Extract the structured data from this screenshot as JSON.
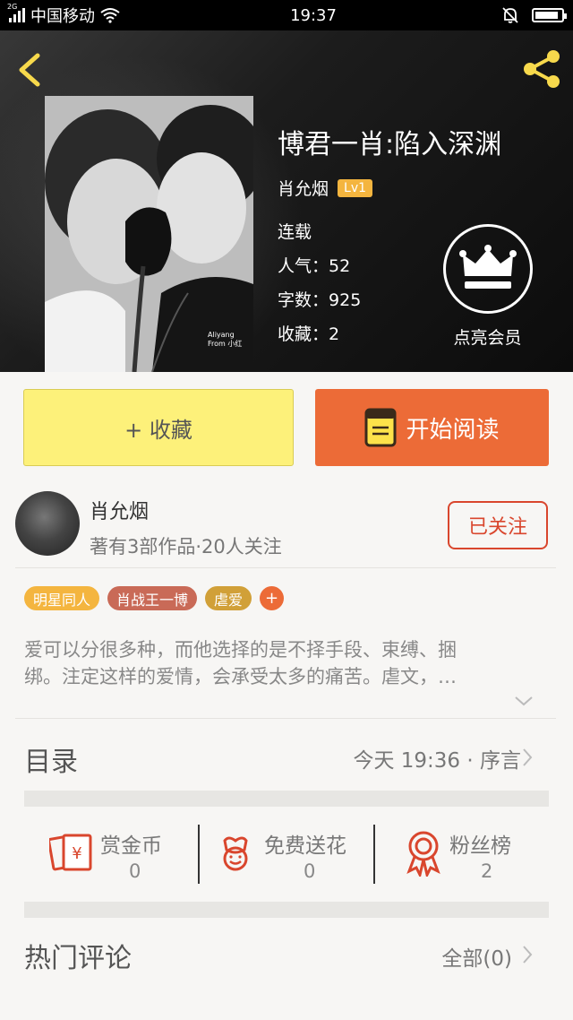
{
  "status_bar": {
    "network": "2G",
    "carrier": "中国移动",
    "time": "19:37",
    "battery_level": 0.9
  },
  "book": {
    "title": "博君一肖:陷入深渊",
    "author": "肖允烟",
    "level": "Lv1",
    "status": "连载",
    "popularity_label": "人气：",
    "popularity": "52",
    "words_label": "字数：",
    "words": "925",
    "favorites_label": "收藏：",
    "favorites": "2",
    "cover_watermark": "Aliyang From 小红"
  },
  "vip": {
    "label": "点亮会员"
  },
  "actions": {
    "collect": "+ 收藏",
    "read": "开始阅读"
  },
  "author_block": {
    "name": "肖允烟",
    "subtitle": "著有3部作品·20人关注",
    "follow": "已关注"
  },
  "tags": [
    {
      "label": "明星同人",
      "color": "#f4b53f"
    },
    {
      "label": "肖战王一博",
      "color": "#c96a57"
    },
    {
      "label": "虐爱",
      "color": "#d1a038"
    }
  ],
  "synopsis": {
    "line1": "爱可以分很多种，而他选择的是不择手段、束缚、捆",
    "line2": "绑。注定这样的爱情，会承受太多的痛苦。虐文，…"
  },
  "catalog": {
    "title": "目录",
    "meta": "今天 19:36 · 序言"
  },
  "rewards": [
    {
      "label": "赏金币",
      "count": "0",
      "icon": "red-envelope-icon"
    },
    {
      "label": "免费送花",
      "count": "0",
      "icon": "flower-icon"
    },
    {
      "label": "粉丝榜",
      "count": "2",
      "icon": "award-ribbon-icon"
    }
  ],
  "comments": {
    "title": "热门评论",
    "all": "全部(0)"
  },
  "colors": {
    "accent_orange": "#ec6b37",
    "collect_yellow": "#fdf17a",
    "follow_red": "#d9462d",
    "share_yellow": "#f7d94c"
  }
}
